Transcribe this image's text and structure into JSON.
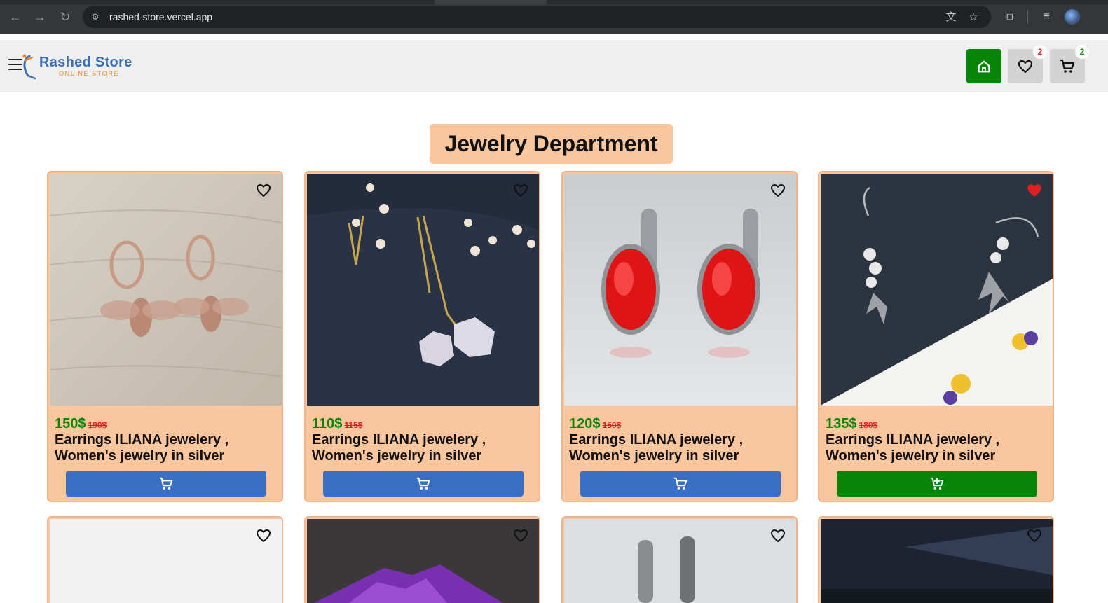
{
  "browser": {
    "url": "rashed-store.vercel.app",
    "back_icon": "arrow-left-icon",
    "forward_icon": "arrow-right-icon",
    "reload_icon": "reload-icon"
  },
  "header": {
    "brand_name": "Rashed Store",
    "brand_tagline": "ONLINE STORE",
    "wishlist_count": "2",
    "cart_count": "2"
  },
  "page": {
    "title": "Jewelry Department"
  },
  "products": [
    {
      "price": "150$",
      "old_price": "190$",
      "name": "Earrings ILIANA jewelery , Women's jewelry in silver",
      "favorited": false,
      "in_cart": false
    },
    {
      "price": "110$",
      "old_price": "115$",
      "name": "Earrings ILIANA jewelery , Women's jewelry in silver",
      "favorited": false,
      "in_cart": false
    },
    {
      "price": "120$",
      "old_price": "150$",
      "name": "Earrings ILIANA jewelery , Women's jewelry in silver",
      "favorited": false,
      "in_cart": false
    },
    {
      "price": "135$",
      "old_price": "180$",
      "name": "Earrings ILIANA jewelery , Women's jewelry in silver",
      "favorited": true,
      "in_cart": true
    }
  ],
  "colors": {
    "accent_green": "#078507",
    "accent_blue": "#3a6fc4",
    "card_bg": "#f9c69e",
    "sale_red": "#e02020"
  }
}
